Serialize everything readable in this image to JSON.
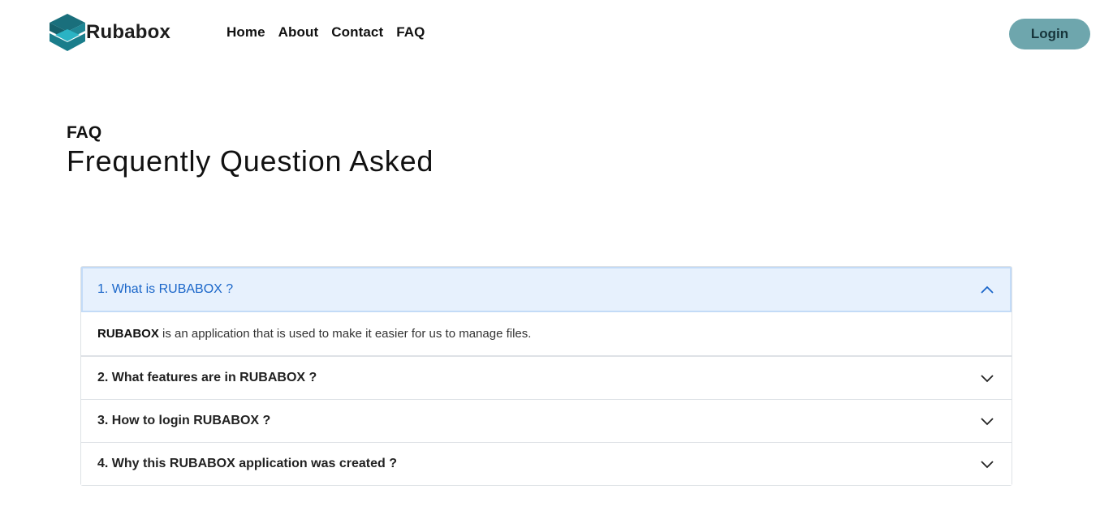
{
  "brand": {
    "name": "Rubabox",
    "logo_icon": "box-logo-icon",
    "logo_colors": [
      "#1a6f7c",
      "#2ab3c4"
    ]
  },
  "nav": {
    "items": [
      "Home",
      "About",
      "Contact",
      "FAQ"
    ]
  },
  "login": {
    "label": "Login",
    "color": "#6ea6ad"
  },
  "faq": {
    "label": "FAQ",
    "title": "Frequently Question Asked",
    "items": [
      {
        "question": "1. What is RUBABOX ?",
        "expanded": true,
        "answer_strong": "RUBABOX",
        "answer_rest": " is an application that is used to make it easier for us to manage files."
      },
      {
        "question": "2. What features are in RUBABOX ?",
        "expanded": false
      },
      {
        "question": "3. How to login RUBABOX ?",
        "expanded": false
      },
      {
        "question": "4. Why this RUBABOX application was created ?",
        "expanded": false
      }
    ]
  },
  "colors": {
    "accent": "#1a66c9",
    "open_bg": "#e7f1fd"
  }
}
